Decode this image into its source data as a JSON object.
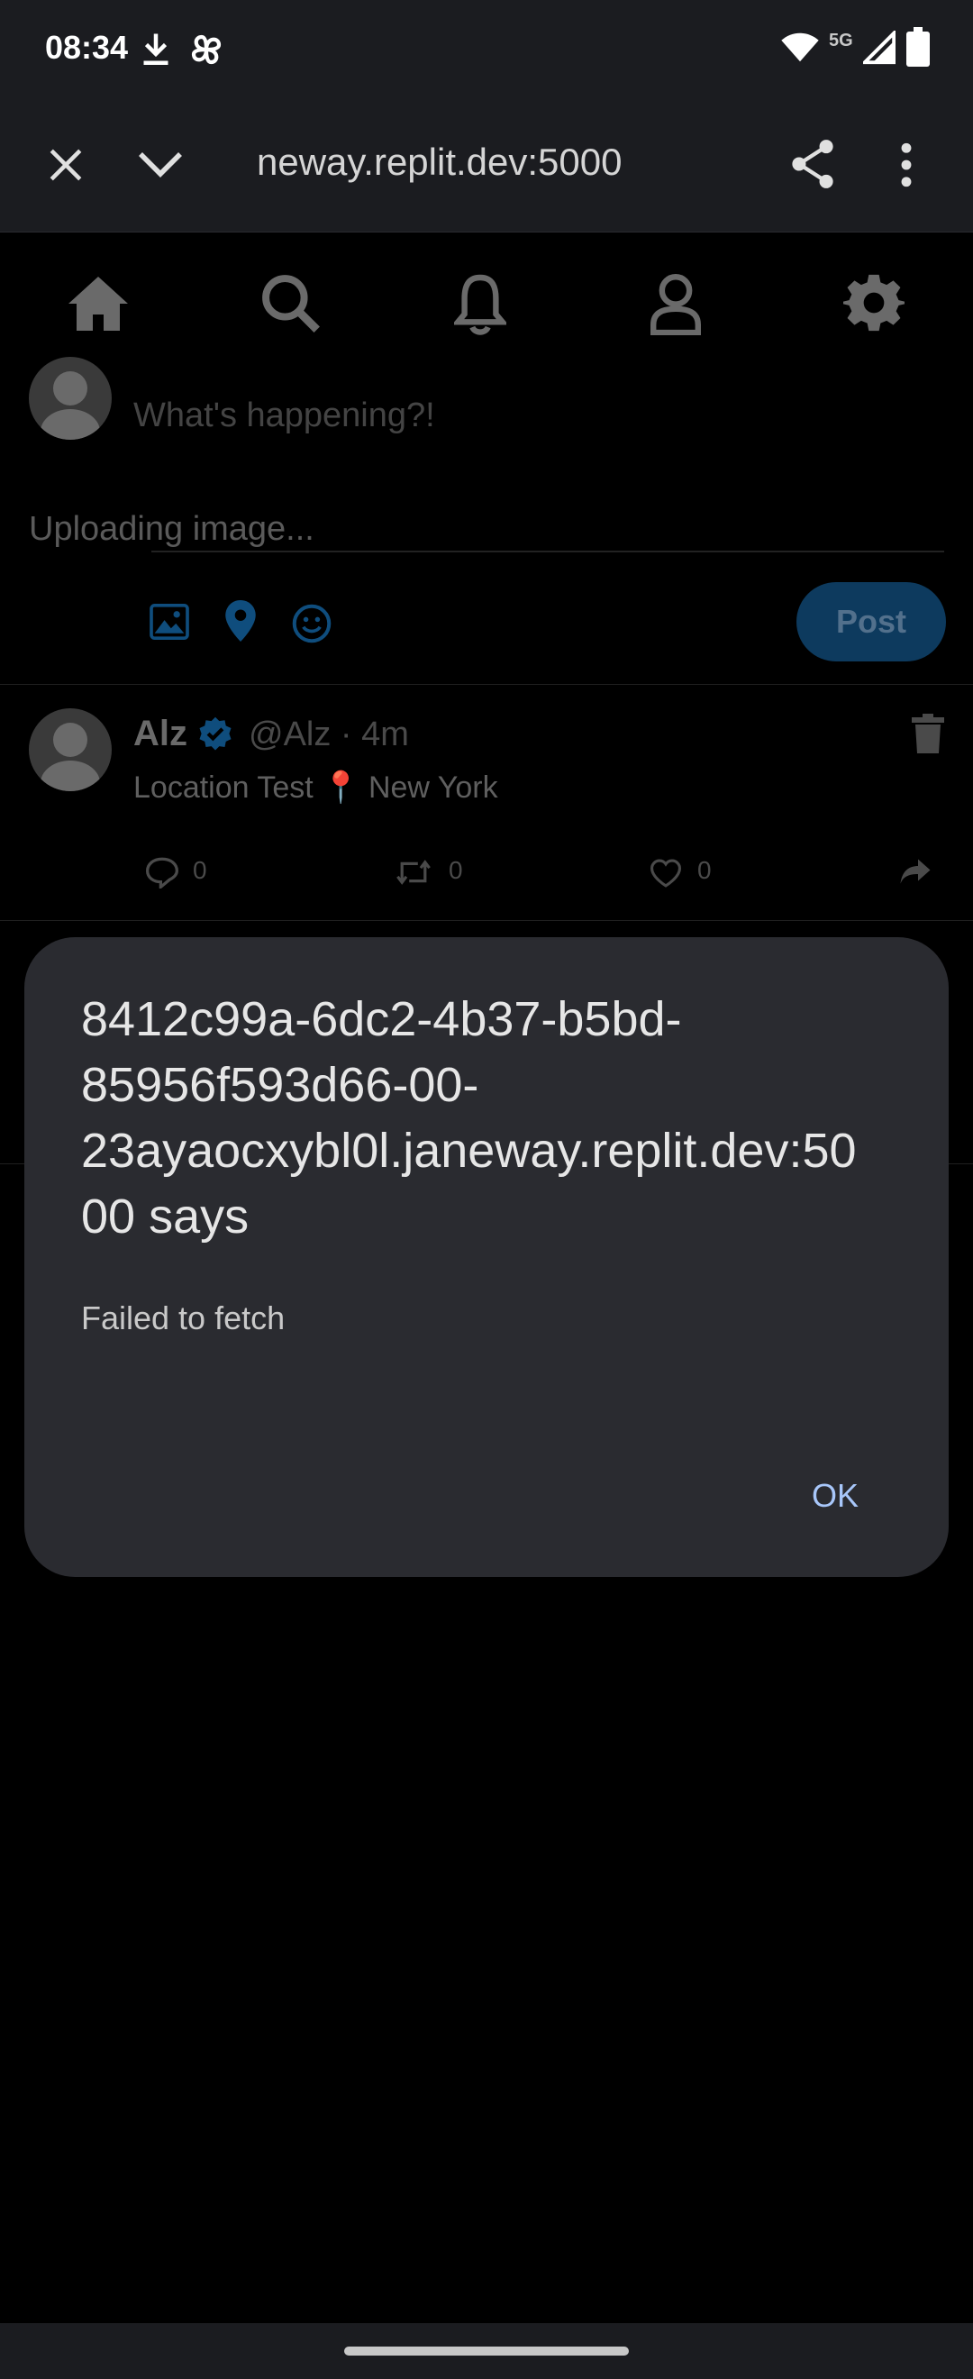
{
  "status_bar": {
    "time": "08:34",
    "network": "5G",
    "icons": [
      "download-icon",
      "pinwheel-icon",
      "wifi-icon",
      "signal-icon",
      "battery-icon"
    ]
  },
  "browser": {
    "url": "neway.replit.dev:5000",
    "icons": [
      "close-icon",
      "chevron-down-icon",
      "share-icon",
      "more-vert-icon"
    ]
  },
  "nav": {
    "icons": [
      "home-icon",
      "search-icon",
      "bell-icon",
      "profile-icon",
      "gear-icon"
    ]
  },
  "compose": {
    "placeholder": "What's happening?!",
    "status": "Uploading image...",
    "post_label": "Post",
    "tools": [
      "image-icon",
      "location-icon",
      "emoji-icon"
    ]
  },
  "tweet": {
    "name": "Alz",
    "handle_time": "@Alz · 4m",
    "text": "Location Test 📍 New York",
    "reply_count": "0",
    "retweet_count": "0",
    "like_count": "0"
  },
  "dialog": {
    "title": "8412c99a-6dc2-4b37-b5bd-85956f593d66-00-23ayaocxybl0l.janeway.replit.dev:5000 says",
    "message": "Failed to fetch",
    "ok_label": "OK"
  },
  "colors": {
    "accent": "#1d9bf0",
    "dialog_bg": "#2a2b30",
    "ok_text": "#a8c7fa"
  }
}
